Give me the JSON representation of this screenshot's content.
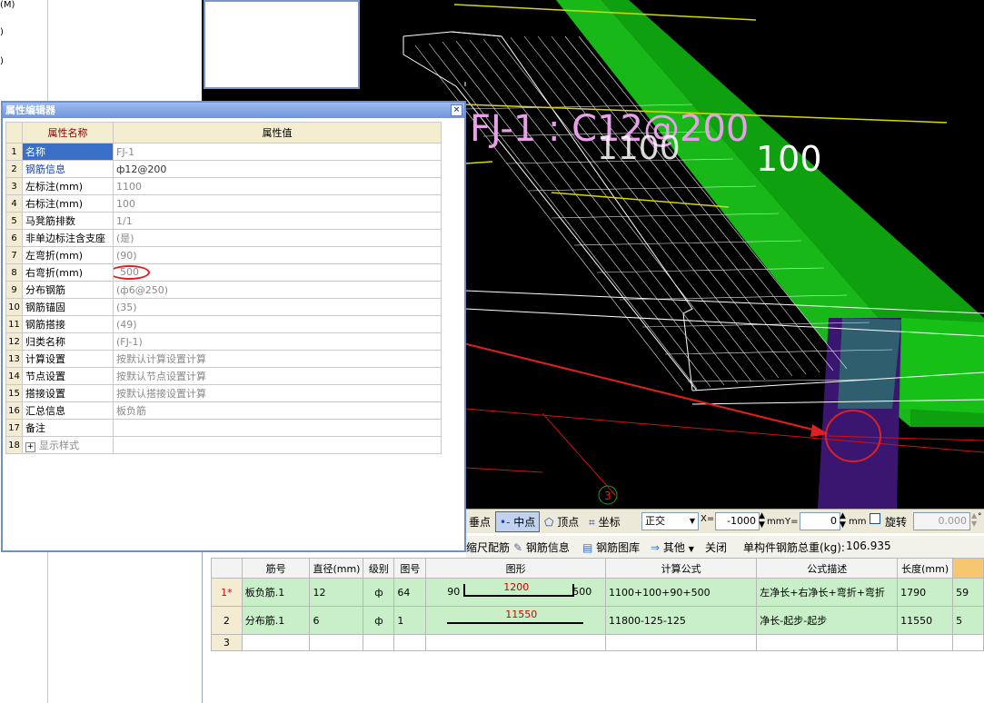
{
  "left_panel": {
    "fragments": [
      "(M)",
      ")",
      ")"
    ]
  },
  "viewport": {
    "labels": {
      "main": "FJ-1 : C12@200",
      "dim_1100": "1100",
      "dim_100": "100",
      "axis_number": "3"
    }
  },
  "property_editor": {
    "title": "属性编辑器",
    "close": "×",
    "headers": {
      "name": "属性名称",
      "value": "属性值"
    },
    "rows": [
      {
        "no": "1",
        "name": "名称",
        "value": "FJ-1"
      },
      {
        "no": "2",
        "name": "钢筋信息",
        "value": "ф12@200"
      },
      {
        "no": "3",
        "name": "左标注(mm)",
        "value": "1100"
      },
      {
        "no": "4",
        "name": "右标注(mm)",
        "value": "100"
      },
      {
        "no": "5",
        "name": "马凳筋排数",
        "value": "1/1"
      },
      {
        "no": "6",
        "name": "非单边标注含支座",
        "value": "(是)"
      },
      {
        "no": "7",
        "name": "左弯折(mm)",
        "value": "(90)"
      },
      {
        "no": "8",
        "name": "右弯折(mm)",
        "value": "500"
      },
      {
        "no": "9",
        "name": "分布钢筋",
        "value": "(ф6@250)"
      },
      {
        "no": "10",
        "name": "钢筋锚固",
        "value": "(35)"
      },
      {
        "no": "11",
        "name": "钢筋搭接",
        "value": "(49)"
      },
      {
        "no": "12",
        "name": "归类名称",
        "value": "(FJ-1)"
      },
      {
        "no": "13",
        "name": "计算设置",
        "value": "按默认计算设置计算"
      },
      {
        "no": "14",
        "name": "节点设置",
        "value": "按默认节点设置计算"
      },
      {
        "no": "15",
        "name": "搭接设置",
        "value": "按默认搭接设置计算"
      },
      {
        "no": "16",
        "name": "汇总信息",
        "value": "板负筋"
      },
      {
        "no": "17",
        "name": "备注",
        "value": ""
      },
      {
        "no": "18",
        "name": "显示样式",
        "value": ""
      }
    ],
    "expand_symbol": "+"
  },
  "snap_toolbar": {
    "perpendicular": "垂点",
    "midpoint": "中点",
    "vertex": "顶点",
    "coordinate": "坐标",
    "mode_value": "正交",
    "x_label": "X=",
    "x_value": "-1000",
    "unit_mm": "mm",
    "y_label": "Y=",
    "y_value": "0",
    "unit_mm2": "mm",
    "rotate_label": "旋转",
    "rotate_value": "0.000",
    "degree": "°"
  },
  "rebar_toolbar": {
    "scale_rebar": "缩尺配筋",
    "rebar_info": "钢筋信息",
    "rebar_library": "钢筋图库",
    "other": "其他",
    "close": "关闭",
    "total_weight_label": "单构件钢筋总重(kg):",
    "total_weight_value": "106.935"
  },
  "rebar_table": {
    "headers": [
      "",
      "筋号",
      "直径(mm)",
      "级别",
      "图号",
      "图形",
      "计算公式",
      "公式描述",
      "长度(mm)",
      ""
    ],
    "rows": [
      {
        "rn": "1*",
        "name": "板负筋.1",
        "diameter": "12",
        "grade": "ф",
        "fig": "64",
        "shape_left": "90",
        "shape_mid": "1200",
        "shape_right": "500",
        "formula": "1100+100+90+500",
        "desc": "左净长+右净长+弯折+弯折",
        "length": "1790",
        "extra": "59"
      },
      {
        "rn": "2",
        "name": "分布筋.1",
        "diameter": "6",
        "grade": "ф",
        "fig": "1",
        "shape_left": "",
        "shape_mid": "11550",
        "shape_right": "",
        "formula": "11800-125-125",
        "desc": "净长-起步-起步",
        "length": "11550",
        "extra": "5"
      },
      {
        "rn": "3",
        "name": "",
        "diameter": "",
        "grade": "",
        "fig": "",
        "shape_left": "",
        "shape_mid": "",
        "shape_right": "",
        "formula": "",
        "desc": "",
        "length": "",
        "extra": ""
      }
    ]
  },
  "colors": {
    "highlight_red": "#e02020",
    "beam_green": "#19c219",
    "column_purple": "#3b1670",
    "label_pink": "#e8a0e8"
  }
}
